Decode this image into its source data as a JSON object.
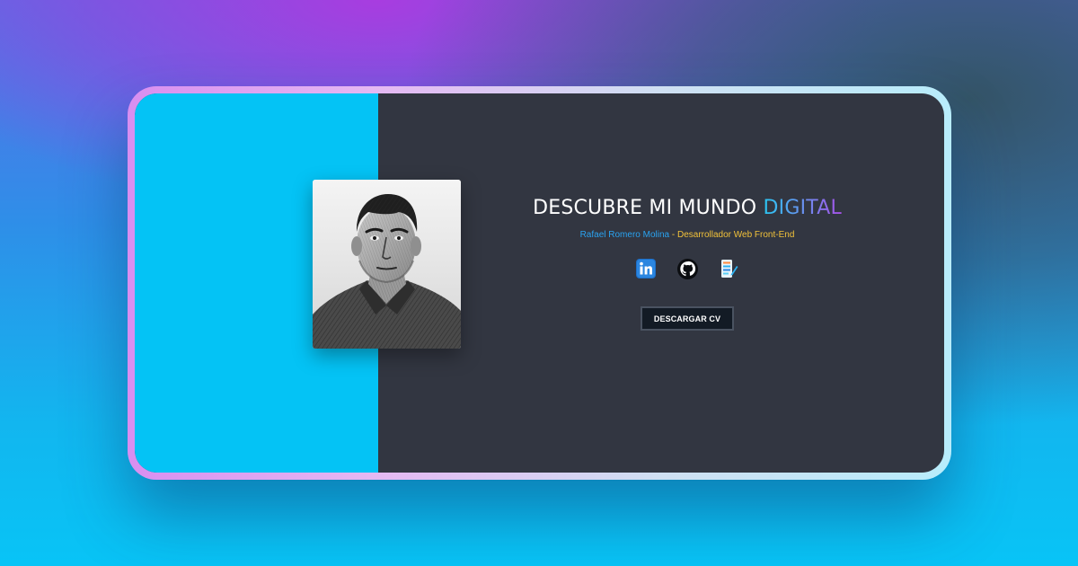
{
  "hero": {
    "headline_main": "DESCUBRE MI MUNDO ",
    "headline_accent": "DIGITAL",
    "name": "Rafael Romero Molina",
    "separator": " - ",
    "role": "Desarrollador Web Front-End"
  },
  "social": [
    {
      "icon": "linkedin-icon"
    },
    {
      "icon": "github-icon"
    },
    {
      "icon": "portfolio-icon"
    }
  ],
  "cv_button": {
    "label": "DESCARGAR CV"
  },
  "colors": {
    "left_panel": "#04c3f5",
    "card_bg": "#323641",
    "name": "#2aa3f0",
    "role": "#f2c23a",
    "button_bg": "#131b25"
  }
}
